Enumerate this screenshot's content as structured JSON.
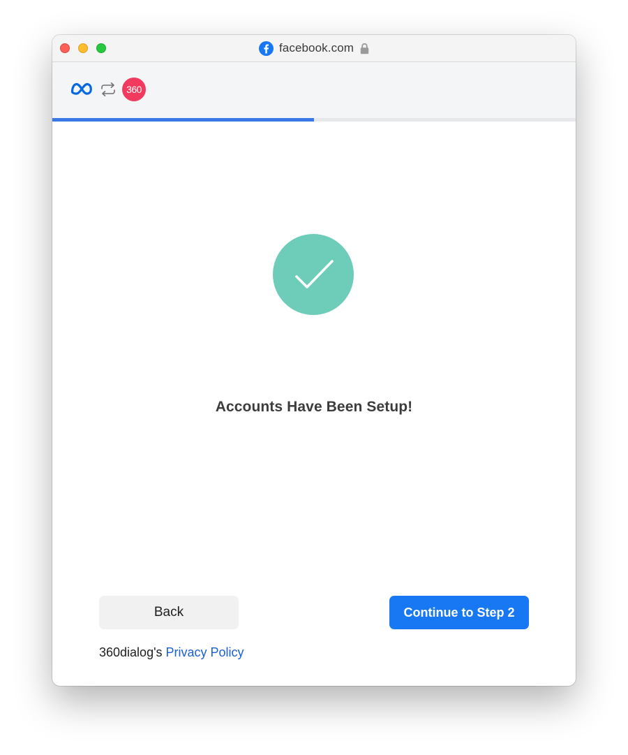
{
  "browser": {
    "url": "facebook.com",
    "site_icon": "facebook-icon",
    "secure_icon": "lock-icon"
  },
  "header": {
    "logos": [
      "meta-logo-icon",
      "swap-arrows-icon",
      "360dialog-logo"
    ],
    "partner_logo_text": "360"
  },
  "progress": {
    "fraction": 0.5
  },
  "status": {
    "icon": "checkmark-icon",
    "title": "Accounts Have Been Setup!"
  },
  "actions": {
    "back_label": "Back",
    "continue_label": "Continue to Step 2"
  },
  "footer": {
    "prefix": "360dialog's",
    "privacy_link": "Privacy Policy"
  },
  "colors": {
    "primary_button": "#1877f2",
    "progress": "#3b78e7",
    "success": "#6dcdb8",
    "partner_badge": "#f23a5f",
    "link": "#1a5fd6"
  }
}
